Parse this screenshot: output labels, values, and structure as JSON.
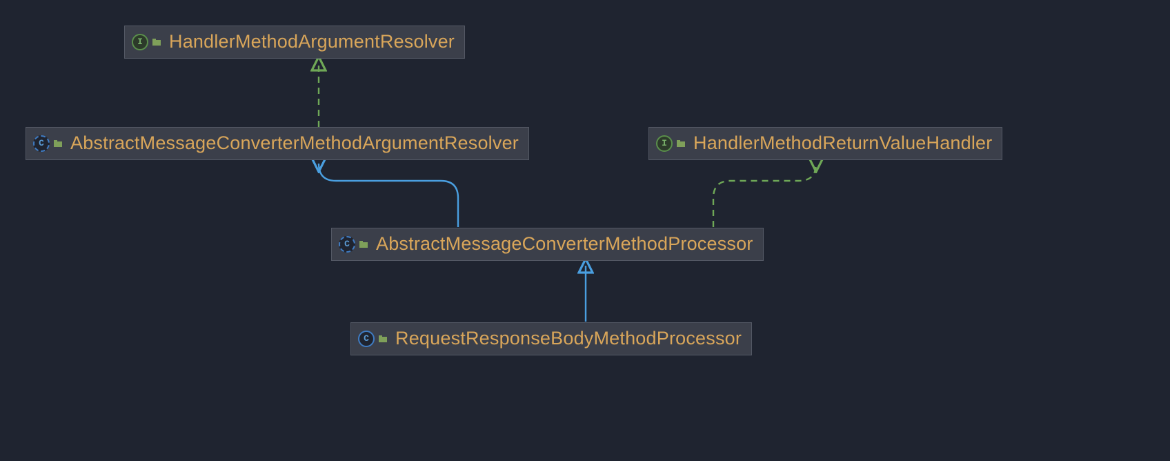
{
  "nodes": {
    "n1": {
      "label": "HandlerMethodArgumentResolver",
      "kind": "interface",
      "glyph": "I"
    },
    "n2": {
      "label": "AbstractMessageConverterMethodArgumentResolver",
      "kind": "abstract",
      "glyph": "C"
    },
    "n3": {
      "label": "HandlerMethodReturnValueHandler",
      "kind": "interface",
      "glyph": "I"
    },
    "n4": {
      "label": "AbstractMessageConverterMethodProcessor",
      "kind": "abstract",
      "glyph": "C"
    },
    "n5": {
      "label": "RequestResponseBodyMethodProcessor",
      "kind": "class",
      "glyph": "C"
    }
  },
  "colors": {
    "extends": "#4a9fe0",
    "implements": "#6fa857"
  }
}
